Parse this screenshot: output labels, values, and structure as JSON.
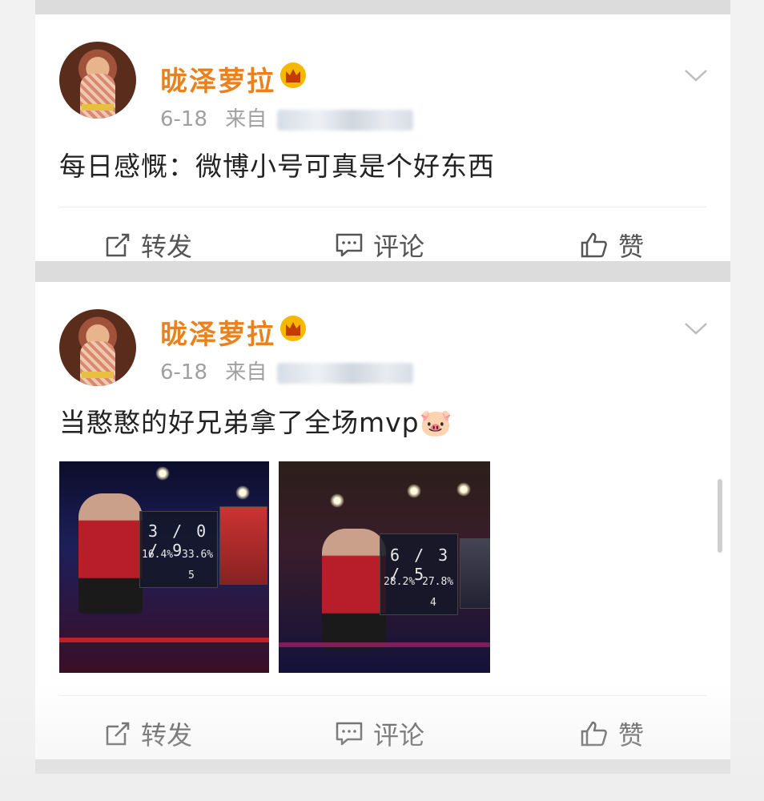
{
  "posts": [
    {
      "username": "昽泽萝拉",
      "date": "6-18",
      "source_prefix": "来自",
      "text": "每日感慨：微博小号可真是个好东西",
      "actions": {
        "repost": "转发",
        "comment": "评论",
        "like": "赞"
      }
    },
    {
      "username": "昽泽萝拉",
      "date": "6-18",
      "source_prefix": "来自",
      "text": "当憨憨的好兄弟拿了全场mvp🐷",
      "images": [
        {
          "kda": "3 / 0 / 9",
          "pct_left": "16.4%",
          "pct_right": "33.6%",
          "count": "5"
        },
        {
          "kda": "6 / 3 / 5",
          "pct_left": "28.2%",
          "pct_right": "27.8%",
          "count": "4"
        }
      ],
      "actions": {
        "repost": "转发",
        "comment": "评论",
        "like": "赞"
      }
    }
  ],
  "colors": {
    "username": "#e8811e",
    "vip_crown": "#f5b700",
    "text": "#222222",
    "meta": "#a0a0a0"
  },
  "icons": {
    "vip": "crown-icon",
    "menu": "chevron-down-icon",
    "repost": "repost-icon",
    "comment": "comment-icon",
    "like": "thumbs-up-icon"
  }
}
